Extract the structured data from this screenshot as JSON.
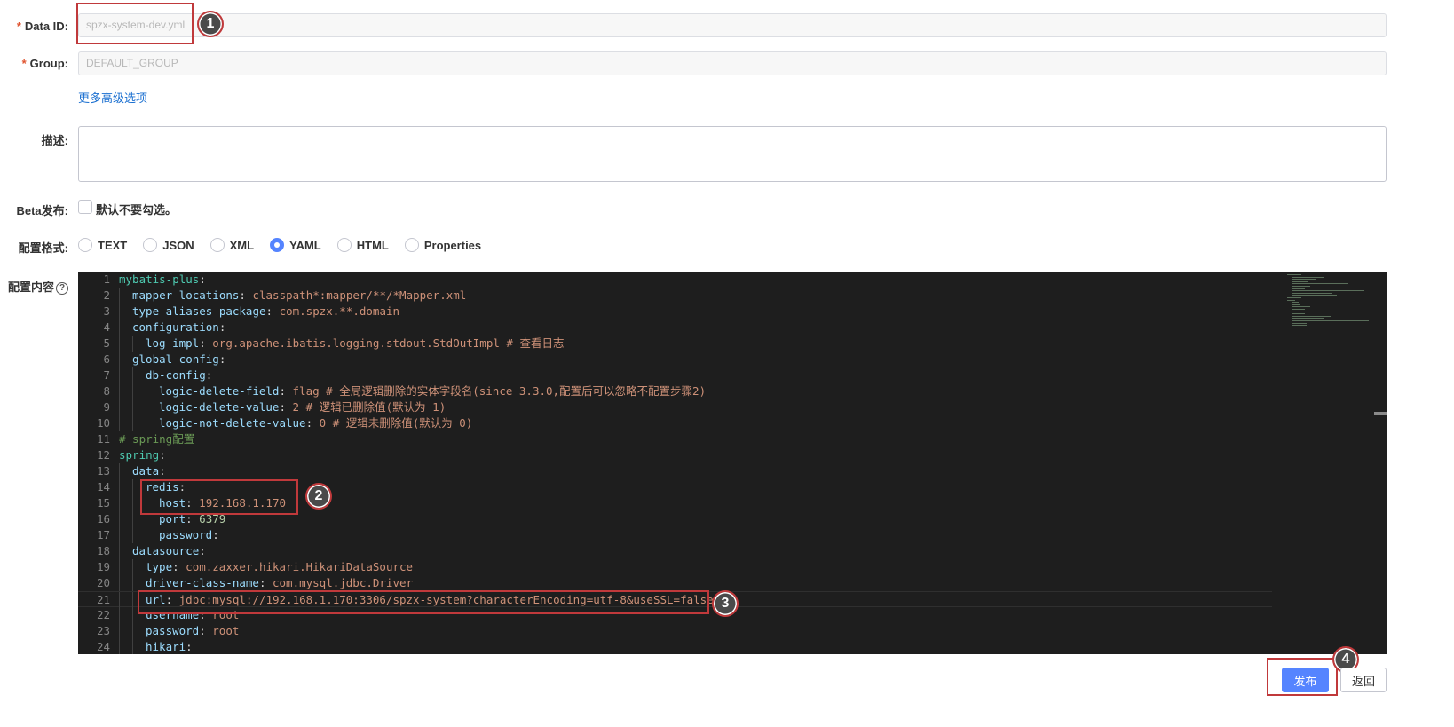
{
  "form": {
    "data_id": {
      "required": "*",
      "label": "Data ID:",
      "value": "spzx-system-dev.yml"
    },
    "group": {
      "required": "*",
      "label": "Group:",
      "value": "DEFAULT_GROUP"
    },
    "advanced_link": "更多高级选项",
    "description": {
      "label": "描述:",
      "value": ""
    },
    "beta": {
      "label": "Beta发布:",
      "checkbox_label": "默认不要勾选。"
    },
    "format": {
      "label": "配置格式:",
      "options": [
        "TEXT",
        "JSON",
        "XML",
        "YAML",
        "HTML",
        "Properties"
      ],
      "selected": "YAML"
    },
    "content": {
      "label": "配置内容",
      "help_icon": "?"
    }
  },
  "editor": {
    "lines": [
      {
        "num": "1",
        "indent": 0,
        "tokens": [
          [
            "k",
            "mybatis-plus"
          ],
          [
            "p",
            ":"
          ]
        ]
      },
      {
        "num": "2",
        "indent": 1,
        "tokens": [
          [
            "k",
            "mapper-locations"
          ],
          [
            "p",
            ": "
          ],
          [
            "s",
            "classpath*:mapper/**/*Mapper.xml"
          ]
        ]
      },
      {
        "num": "3",
        "indent": 1,
        "tokens": [
          [
            "k",
            "type-aliases-package"
          ],
          [
            "p",
            ": "
          ],
          [
            "s",
            "com.spzx.**.domain"
          ]
        ]
      },
      {
        "num": "4",
        "indent": 1,
        "tokens": [
          [
            "k",
            "configuration"
          ],
          [
            "p",
            ":"
          ]
        ]
      },
      {
        "num": "5",
        "indent": 2,
        "tokens": [
          [
            "k",
            "log-impl"
          ],
          [
            "p",
            ": "
          ],
          [
            "s",
            "org.apache.ibatis.logging.stdout.StdOutImpl # 查看日志"
          ]
        ]
      },
      {
        "num": "6",
        "indent": 1,
        "tokens": [
          [
            "k",
            "global-config"
          ],
          [
            "p",
            ":"
          ]
        ]
      },
      {
        "num": "7",
        "indent": 2,
        "tokens": [
          [
            "k",
            "db-config"
          ],
          [
            "p",
            ":"
          ]
        ]
      },
      {
        "num": "8",
        "indent": 3,
        "tokens": [
          [
            "k",
            "logic-delete-field"
          ],
          [
            "p",
            ": "
          ],
          [
            "s",
            "flag # 全局逻辑删除的实体字段名(since 3.3.0,配置后可以忽略不配置步骤2)"
          ]
        ]
      },
      {
        "num": "9",
        "indent": 3,
        "tokens": [
          [
            "k",
            "logic-delete-value"
          ],
          [
            "p",
            ": "
          ],
          [
            "s",
            "2 # 逻辑已删除值(默认为 1)"
          ]
        ]
      },
      {
        "num": "10",
        "indent": 3,
        "tokens": [
          [
            "k",
            "logic-not-delete-value"
          ],
          [
            "p",
            ": "
          ],
          [
            "s",
            "0 # 逻辑未删除值(默认为 0)"
          ]
        ]
      },
      {
        "num": "11",
        "indent": 0,
        "tokens": [
          [
            "c",
            "# spring配置"
          ]
        ]
      },
      {
        "num": "12",
        "indent": 0,
        "tokens": [
          [
            "k",
            "spring"
          ],
          [
            "p",
            ":"
          ]
        ]
      },
      {
        "num": "13",
        "indent": 1,
        "tokens": [
          [
            "k",
            "data"
          ],
          [
            "p",
            ":"
          ]
        ]
      },
      {
        "num": "14",
        "indent": 2,
        "tokens": [
          [
            "k",
            "redis"
          ],
          [
            "p",
            ":"
          ]
        ]
      },
      {
        "num": "15",
        "indent": 3,
        "tokens": [
          [
            "k",
            "host"
          ],
          [
            "p",
            ": "
          ],
          [
            "s",
            "192.168.1.170"
          ]
        ]
      },
      {
        "num": "16",
        "indent": 3,
        "tokens": [
          [
            "k",
            "port"
          ],
          [
            "p",
            ": "
          ],
          [
            "n",
            "6379"
          ]
        ]
      },
      {
        "num": "17",
        "indent": 3,
        "tokens": [
          [
            "k",
            "password"
          ],
          [
            "p",
            ":"
          ]
        ]
      },
      {
        "num": "18",
        "indent": 1,
        "tokens": [
          [
            "k",
            "datasource"
          ],
          [
            "p",
            ":"
          ]
        ]
      },
      {
        "num": "19",
        "indent": 2,
        "tokens": [
          [
            "k",
            "type"
          ],
          [
            "p",
            ": "
          ],
          [
            "s",
            "com.zaxxer.hikari.HikariDataSource"
          ]
        ]
      },
      {
        "num": "20",
        "indent": 2,
        "tokens": [
          [
            "k",
            "driver-class-name"
          ],
          [
            "p",
            ": "
          ],
          [
            "s",
            "com.mysql.jdbc.Driver"
          ]
        ]
      },
      {
        "num": "21",
        "indent": 2,
        "tokens": [
          [
            "k",
            "url"
          ],
          [
            "p",
            ": "
          ],
          [
            "s",
            "jdbc:mysql://192.168.1.170:3306/spzx-system?characterEncoding=utf-8&useSSL=false"
          ]
        ]
      },
      {
        "num": "22",
        "indent": 2,
        "tokens": [
          [
            "k",
            "username"
          ],
          [
            "p",
            ": "
          ],
          [
            "s",
            "root"
          ]
        ]
      },
      {
        "num": "23",
        "indent": 2,
        "tokens": [
          [
            "k",
            "password"
          ],
          [
            "p",
            ": "
          ],
          [
            "s",
            "root"
          ]
        ]
      },
      {
        "num": "24",
        "indent": 2,
        "tokens": [
          [
            "k",
            "hikari"
          ],
          [
            "p",
            ":"
          ]
        ]
      }
    ]
  },
  "annotations": {
    "one": "1",
    "two": "2",
    "three": "3",
    "four": "4"
  },
  "footer": {
    "publish": "发布",
    "back": "返回"
  },
  "colors": {
    "primary": "#5584ff",
    "highlight": "#c0393b",
    "editor_bg": "#1e1e1e"
  }
}
